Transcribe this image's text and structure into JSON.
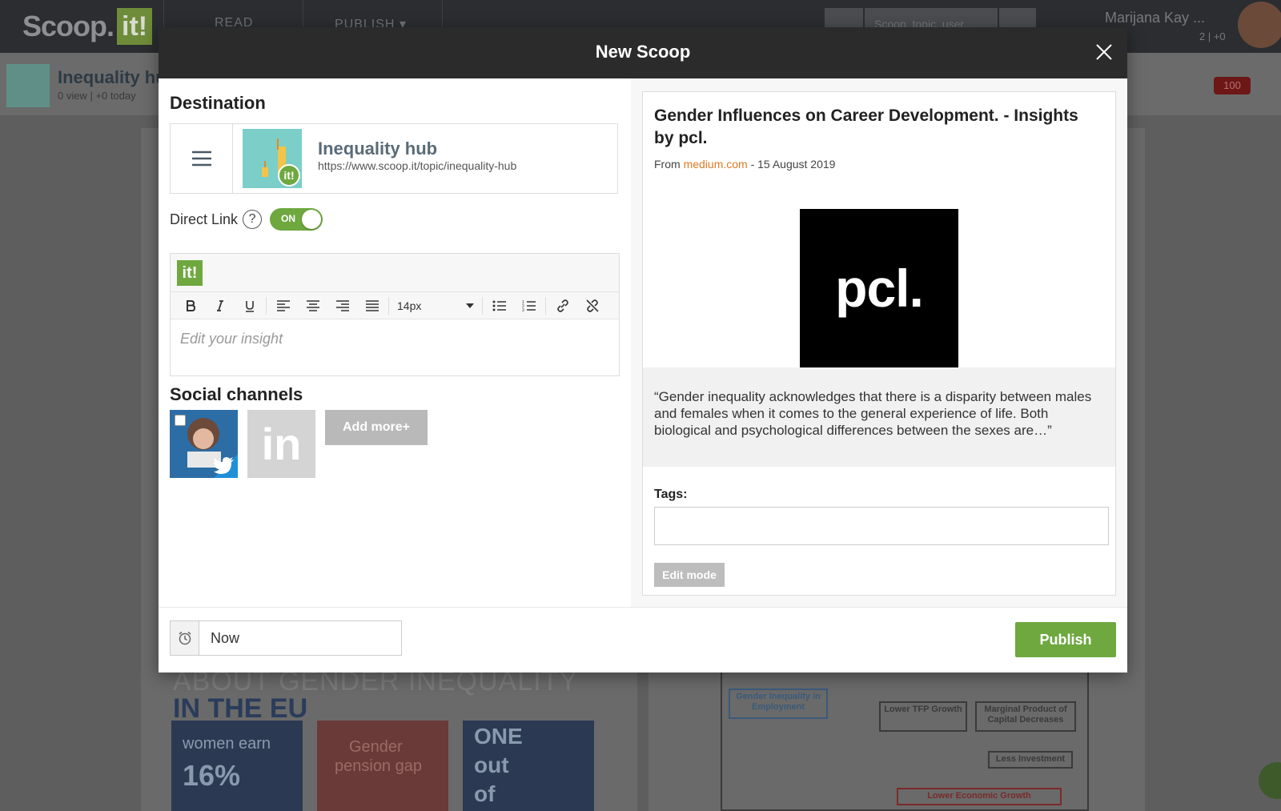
{
  "app": {
    "logo_text": "Scoop.",
    "logo_it": "it!",
    "nav": [
      "READ",
      "PUBLISH"
    ],
    "search_placeholder": "Scoop, topic, user...",
    "user_name": "Marijana Kay ...",
    "user_stats": "2 | +0",
    "hub_title": "Inequality hub",
    "hub_stats": "0 view | +0 today",
    "notification_count": "100"
  },
  "background": {
    "heading_line1": "ABOUT GENDER INEQUALITY",
    "heading_line2": "IN THE EU",
    "tile1_line1": "women earn",
    "tile1_line2": "16%",
    "tile2_line1": "Gender",
    "tile2_line2": "pension gap",
    "tile3_line1": "ONE",
    "tile3_line2": "out",
    "tile3_line3": "of",
    "flow_boxes": {
      "gender": "Gender Inequality in Employment",
      "tfp": "Lower TFP Growth",
      "marginal": "Marginal Product of Capital Decreases",
      "investment": "Less Investment",
      "economic": "Lower Economic Growth"
    }
  },
  "modal": {
    "title": "New Scoop",
    "destination": {
      "heading": "Destination",
      "topic_name": "Inequality hub",
      "topic_url": "https://www.scoop.it/topic/inequality-hub",
      "thumb_badge": "it!"
    },
    "direct_link": {
      "label": "Direct Link",
      "help": "?",
      "toggle_state": "ON"
    },
    "editor": {
      "badge": "it!",
      "font_size": "14px",
      "placeholder": "Edit your insight"
    },
    "social": {
      "heading": "Social channels",
      "linkedin_label": "in",
      "add_more": "Add more+"
    },
    "preview": {
      "title": "Gender Influences on Career Development. - Insights by pcl.",
      "from_prefix": "From",
      "source": "medium.com",
      "date_sep": "- 15 August 2019",
      "image_text": "pcl.",
      "quote": "“Gender inequality acknowledges that there is a disparity between males and females when it comes to the general experience of life. Both biological and psychological differences between the sexes are…”",
      "tags_label": "Tags:",
      "edit_mode": "Edit mode"
    },
    "footer": {
      "schedule_value": "Now",
      "publish": "Publish"
    }
  },
  "colors": {
    "accent_green": "#6ea83f",
    "source_orange": "#e07a24",
    "header_dark": "#2b2b2b"
  }
}
